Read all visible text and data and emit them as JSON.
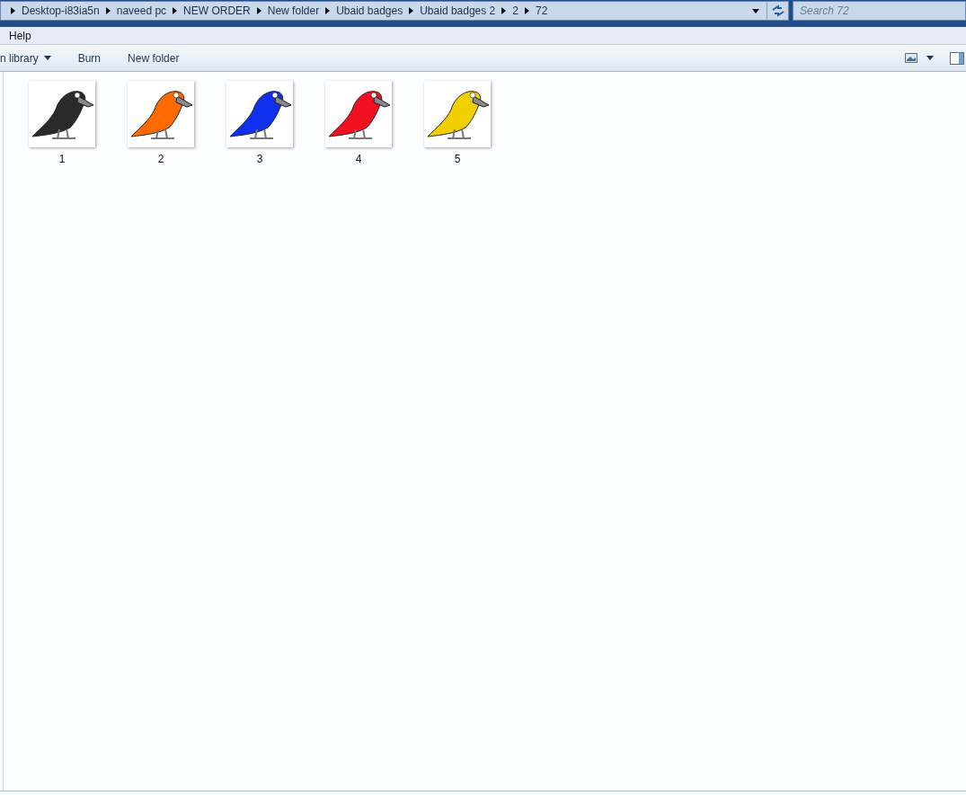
{
  "address_bar": {
    "path": [
      "Desktop-i83ia5n",
      "naveed pc",
      "NEW ORDER",
      "New folder",
      "Ubaid badges",
      "Ubaid badges 2",
      "2",
      "72"
    ]
  },
  "search": {
    "placeholder": "Search 72"
  },
  "menu": [
    "Help"
  ],
  "toolbar": [
    {
      "label": "n library",
      "dropdown": true
    },
    {
      "label": "Burn",
      "dropdown": false
    },
    {
      "label": "New folder",
      "dropdown": false
    }
  ],
  "files": [
    {
      "name": "1",
      "color": "#2a2a2a"
    },
    {
      "name": "2",
      "color": "#ff6a00"
    },
    {
      "name": "3",
      "color": "#1030f0"
    },
    {
      "name": "4",
      "color": "#f01020"
    },
    {
      "name": "5",
      "color": "#f2d000"
    }
  ]
}
